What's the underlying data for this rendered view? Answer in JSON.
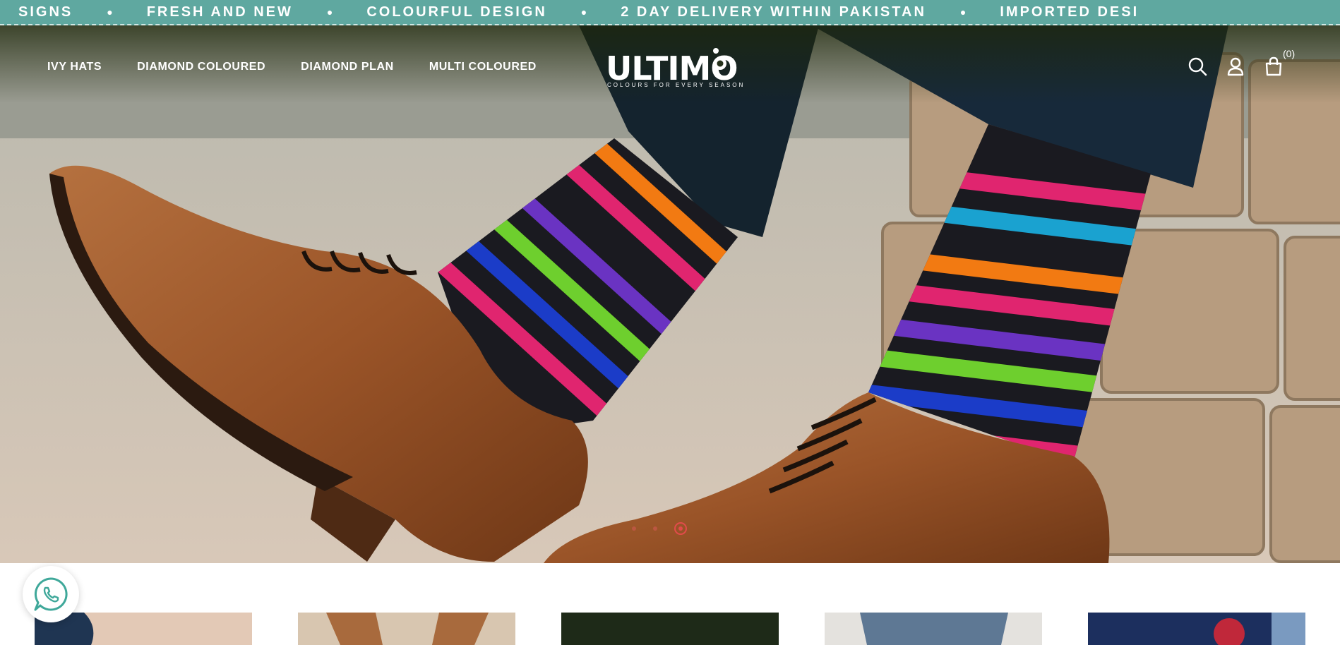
{
  "announcement": {
    "items": [
      "SIGNS",
      "FRESH AND NEW",
      "COLOURFUL DESIGN",
      "2 DAY DELIVERY WITHIN PAKISTAN",
      "IMPORTED DESI"
    ]
  },
  "header": {
    "nav": [
      {
        "label": "IVY HATS"
      },
      {
        "label": "DIAMOND COLOURED"
      },
      {
        "label": "DIAMOND PLAN"
      },
      {
        "label": "MULTI COLOURED"
      }
    ],
    "logo": {
      "text": "ULTIMO",
      "tagline": "COLOURS FOR EVERY SEASON"
    },
    "cart_count": "(0)",
    "icons": [
      "search-icon",
      "account-icon",
      "cart-icon"
    ]
  },
  "hero": {
    "slides_total": 3,
    "active_slide": 3
  },
  "colors": {
    "announce_bg": "#5fa8a0",
    "dot_active": "#e24b4b",
    "whatsapp": "#3fa89a"
  }
}
